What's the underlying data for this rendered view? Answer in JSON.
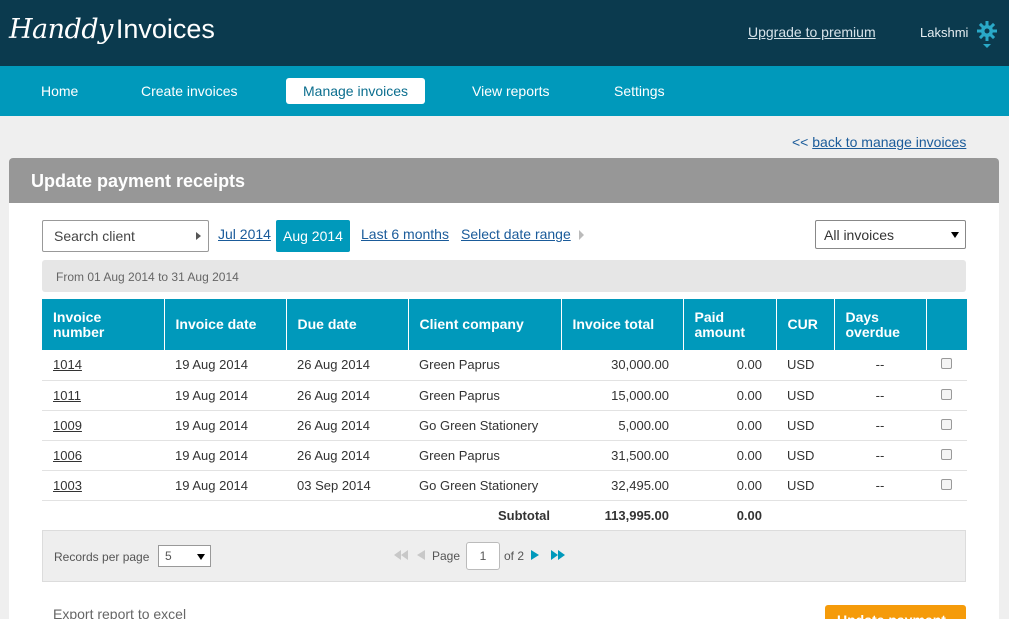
{
  "header": {
    "logo_script": "Handdy",
    "logo_rest": "Invoices",
    "upgrade_label": "Upgrade to premium",
    "username": "Lakshmi"
  },
  "nav": {
    "items": [
      "Home",
      "Create invoices",
      "Manage invoices",
      "View reports",
      "Settings"
    ],
    "active": "Manage invoices"
  },
  "back_link": {
    "chevrons": "<<",
    "label": "back to manage invoices"
  },
  "panel": {
    "title": "Update payment receipts"
  },
  "filters": {
    "search_client": "Search client",
    "prev_month": "Jul 2014",
    "current_month": "Aug 2014",
    "last_6_months": "Last 6 months",
    "select_date_range": "Select date range",
    "invoice_filter": "All invoices"
  },
  "range_text": "From 01 Aug 2014 to 31 Aug 2014",
  "table": {
    "headers": {
      "invoice_number": "Invoice number",
      "invoice_date": "Invoice date",
      "due_date": "Due date",
      "client_company": "Client company",
      "invoice_total": "Invoice total",
      "paid_amount": "Paid amount",
      "currency": "CUR",
      "days_overdue": "Days overdue"
    },
    "rows": [
      {
        "invoice": "1014",
        "inv_date": "19 Aug 2014",
        "due_date": "26 Aug 2014",
        "client": "Green Paprus",
        "total": "30,000.00",
        "paid": "0.00",
        "cur": "USD",
        "overdue": "--"
      },
      {
        "invoice": "1011",
        "inv_date": "19 Aug 2014",
        "due_date": "26 Aug 2014",
        "client": "Green Paprus",
        "total": "15,000.00",
        "paid": "0.00",
        "cur": "USD",
        "overdue": "--"
      },
      {
        "invoice": "1009",
        "inv_date": "19 Aug 2014",
        "due_date": "26 Aug 2014",
        "client": "Go Green Stationery",
        "total": "5,000.00",
        "paid": "0.00",
        "cur": "USD",
        "overdue": "--"
      },
      {
        "invoice": "1006",
        "inv_date": "19 Aug 2014",
        "due_date": "26 Aug 2014",
        "client": "Green Paprus",
        "total": "31,500.00",
        "paid": "0.00",
        "cur": "USD",
        "overdue": "--"
      },
      {
        "invoice": "1003",
        "inv_date": "19 Aug 2014",
        "due_date": "03 Sep 2014",
        "client": "Go Green Stationery",
        "total": "32,495.00",
        "paid": "0.00",
        "cur": "USD",
        "overdue": "--"
      }
    ],
    "subtotal_label": "Subtotal",
    "subtotal_total": "113,995.00",
    "subtotal_paid": "0.00"
  },
  "pager": {
    "records_label": "Records per page",
    "records_value": "5",
    "page_label": "Page",
    "page_value": "1",
    "of_label": "of 2"
  },
  "footer": {
    "export_label": "Export report to excel",
    "update_label": "Update payment"
  },
  "colors": {
    "header_bg": "#0b3a4e",
    "nav_bg": "#0099bb",
    "panel_head_bg": "#979797",
    "update_button": "#f59b0a"
  }
}
